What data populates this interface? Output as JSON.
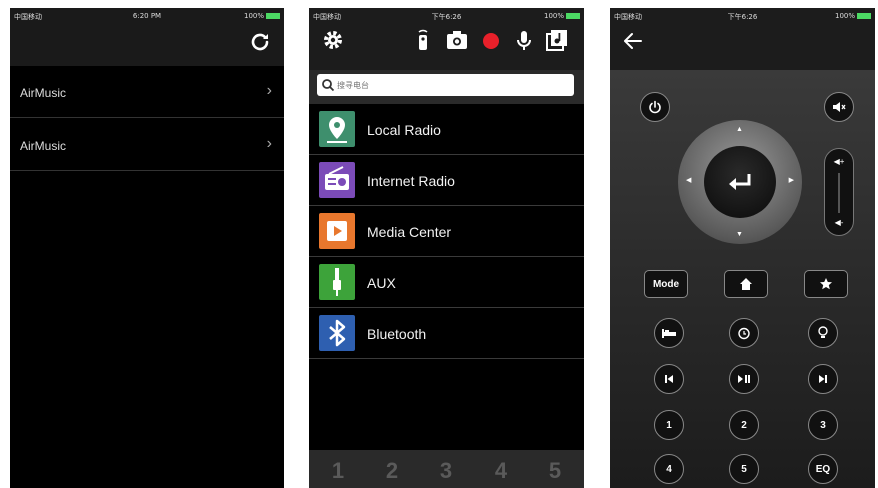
{
  "phone1": {
    "status": {
      "carrier": "中国移动",
      "time": "6:20 PM",
      "battery": "100%"
    },
    "refresh_icon": "refresh-icon",
    "devices": [
      {
        "name": "AirMusic"
      },
      {
        "name": "AirMusic"
      }
    ]
  },
  "phone2": {
    "status": {
      "carrier": "中国移动",
      "time": "下午6:26",
      "battery": "100%"
    },
    "header_icons": [
      "gear-icon",
      "remote-icon",
      "camera-icon",
      "record-icon",
      "microphone-icon",
      "music-icon"
    ],
    "search": {
      "placeholder": "搜寻电台"
    },
    "sources": [
      {
        "label": "Local Radio",
        "icon": "local-radio-icon",
        "color": "#3e8f6d"
      },
      {
        "label": "Internet Radio",
        "icon": "internet-radio-icon",
        "color": "#7b4bb8"
      },
      {
        "label": "Media Center",
        "icon": "media-center-icon",
        "color": "#e8772d"
      },
      {
        "label": "AUX",
        "icon": "aux-icon",
        "color": "#3da33a"
      },
      {
        "label": "Bluetooth",
        "icon": "bluetooth-icon",
        "color": "#2e5fb0"
      }
    ],
    "presets": [
      "1",
      "2",
      "3",
      "4",
      "5"
    ]
  },
  "phone3": {
    "status": {
      "carrier": "中国移动",
      "time": "下午6:26",
      "battery": "100%"
    },
    "buttons": {
      "mode": "Mode",
      "row_nums_1": [
        "1",
        "2",
        "3"
      ],
      "row_nums_2": [
        "4",
        "5",
        "EQ"
      ]
    }
  }
}
